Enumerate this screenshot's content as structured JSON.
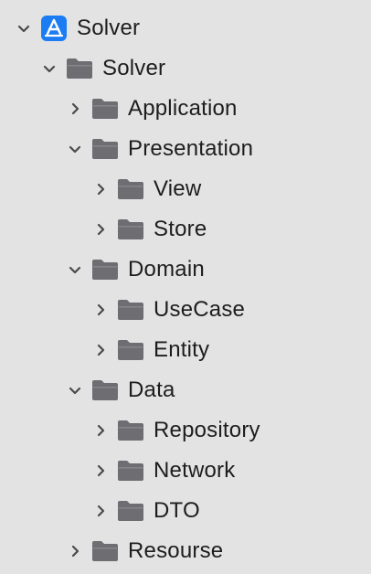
{
  "tree": [
    {
      "label": "Solver",
      "level": 0,
      "expanded": true,
      "icon": "xcode-project-icon"
    },
    {
      "label": "Solver",
      "level": 1,
      "expanded": true,
      "icon": "folder-icon"
    },
    {
      "label": "Application",
      "level": 2,
      "expanded": false,
      "icon": "folder-icon"
    },
    {
      "label": "Presentation",
      "level": 2,
      "expanded": true,
      "icon": "folder-icon"
    },
    {
      "label": "View",
      "level": 3,
      "expanded": false,
      "icon": "folder-icon"
    },
    {
      "label": "Store",
      "level": 3,
      "expanded": false,
      "icon": "folder-icon"
    },
    {
      "label": "Domain",
      "level": 2,
      "expanded": true,
      "icon": "folder-icon"
    },
    {
      "label": "UseCase",
      "level": 3,
      "expanded": false,
      "icon": "folder-icon"
    },
    {
      "label": "Entity",
      "level": 3,
      "expanded": false,
      "icon": "folder-icon"
    },
    {
      "label": "Data",
      "level": 2,
      "expanded": true,
      "icon": "folder-icon"
    },
    {
      "label": "Repository",
      "level": 3,
      "expanded": false,
      "icon": "folder-icon"
    },
    {
      "label": "Network",
      "level": 3,
      "expanded": false,
      "icon": "folder-icon"
    },
    {
      "label": "DTO",
      "level": 3,
      "expanded": false,
      "icon": "folder-icon"
    },
    {
      "label": "Resourse",
      "level": 2,
      "expanded": false,
      "icon": "folder-icon"
    }
  ],
  "colors": {
    "background": "#e3e3e3",
    "folder": "#6d6d72",
    "chevron": "#4a4a4a",
    "project_icon": "#1b7cf3"
  }
}
